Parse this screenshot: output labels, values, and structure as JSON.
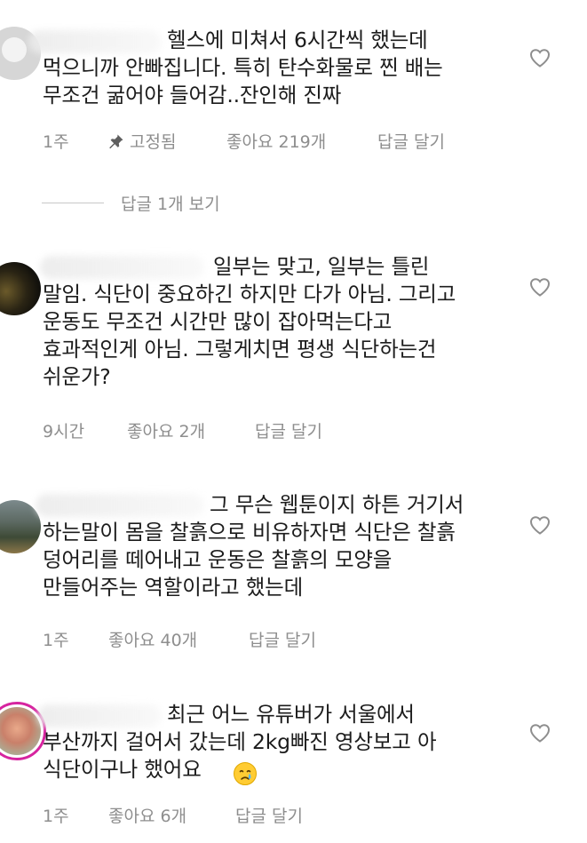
{
  "comments": [
    {
      "first_line": "헬스에 미쳐서 6시간씩 했는데",
      "body": "먹으니까 안빠집니다. 특히 탄수화물로 찐 배는\n무조건 굶어야 들어감..잔인해 진짜",
      "time": "1주",
      "pinned_label": "고정됨",
      "likes": "좋아요 219개",
      "reply": "답글 달기"
    },
    {
      "first_line": "일부는 맞고, 일부는 틀린",
      "body": "말임. 식단이 중요하긴 하지만 다가 아님. 그리고\n운동도 무조건 시간만 많이 잡아먹는다고\n효과적인게 아님. 그렇게치면 평생 식단하는건\n쉬운가?",
      "time": "9시간",
      "likes": "좋아요 2개",
      "reply": "답글 달기"
    },
    {
      "first_line": "그 무슨 웹툰이지 하튼 거기서",
      "body": "하는말이 몸을 찰흙으로 비유하자면 식단은 찰흙\n덩어리를 떼어내고 운동은 찰흙의 모양을\n만들어주는 역할이라고 했는데",
      "time": "1주",
      "likes": "좋아요 40개",
      "reply": "답글 달기"
    },
    {
      "first_line": "최근 어느 유튜버가 서울에서",
      "body": "부산까지 걸어서 갔는데 2kg빠진 영상보고 아\n식단이구나 했어요",
      "time": "1주",
      "likes": "좋아요 6개",
      "reply": "답글 달기"
    }
  ],
  "view_replies_label": "답글 1개 보기",
  "icons": {
    "heart": "heart-outline-icon",
    "pin": "pin-icon",
    "emoji": "crying-face-emoji"
  }
}
